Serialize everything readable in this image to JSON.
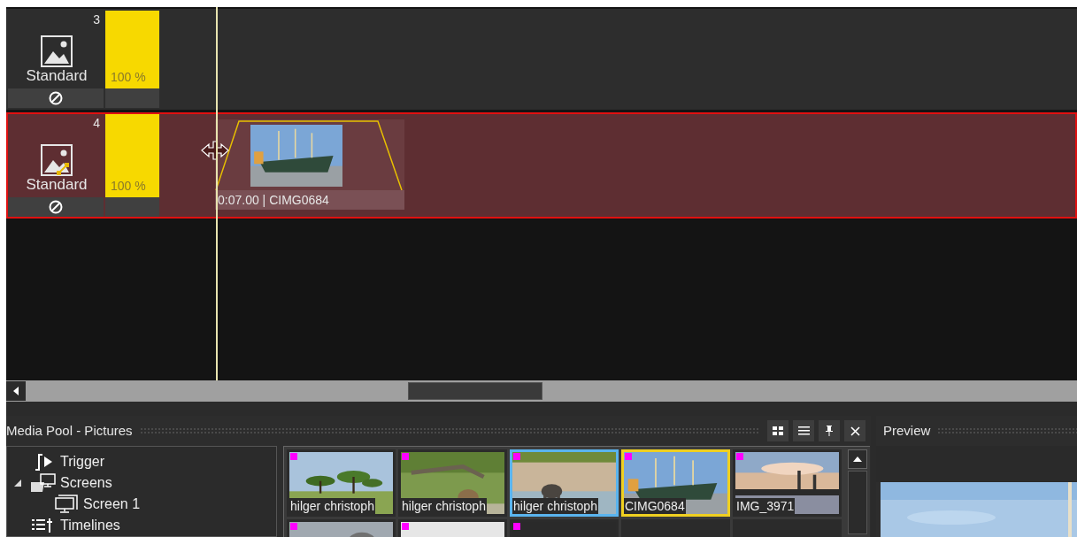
{
  "tracks": [
    {
      "number": "3",
      "label": "Standard",
      "opacity": "100 %",
      "selected": false,
      "keyframes": false
    },
    {
      "number": "4",
      "label": "Standard",
      "opacity": "100 %",
      "selected": true,
      "keyframes": true,
      "clip": {
        "caption": "0:07.00 | CIMG0684"
      }
    }
  ],
  "media_pool": {
    "title": "Media Pool - Pictures",
    "tree": [
      {
        "label": "Trigger",
        "kind": "trigger"
      },
      {
        "label": "Screens",
        "kind": "screens",
        "expanded": true,
        "children": [
          {
            "label": "Screen 1",
            "kind": "screen"
          }
        ]
      },
      {
        "label": "Timelines",
        "kind": "timelines"
      }
    ],
    "thumbnails": [
      {
        "label": "hilger christoph",
        "marked": true,
        "selected": false,
        "in_use": false
      },
      {
        "label": "hilger christoph",
        "marked": true,
        "selected": false,
        "in_use": false
      },
      {
        "label": "hilger christoph",
        "marked": true,
        "selected": true,
        "in_use": false
      },
      {
        "label": "CIMG0684",
        "marked": true,
        "selected": false,
        "in_use": true
      },
      {
        "label": "IMG_3971",
        "marked": true,
        "selected": false,
        "in_use": false
      },
      {
        "marked": true,
        "selected": false,
        "in_use": false
      },
      {
        "marked": true,
        "selected": false,
        "in_use": false
      },
      {
        "marked": true,
        "selected": false,
        "in_use": false
      },
      {
        "kind": "empty"
      },
      {
        "kind": "empty"
      }
    ]
  },
  "preview": {
    "title": "Preview"
  }
}
